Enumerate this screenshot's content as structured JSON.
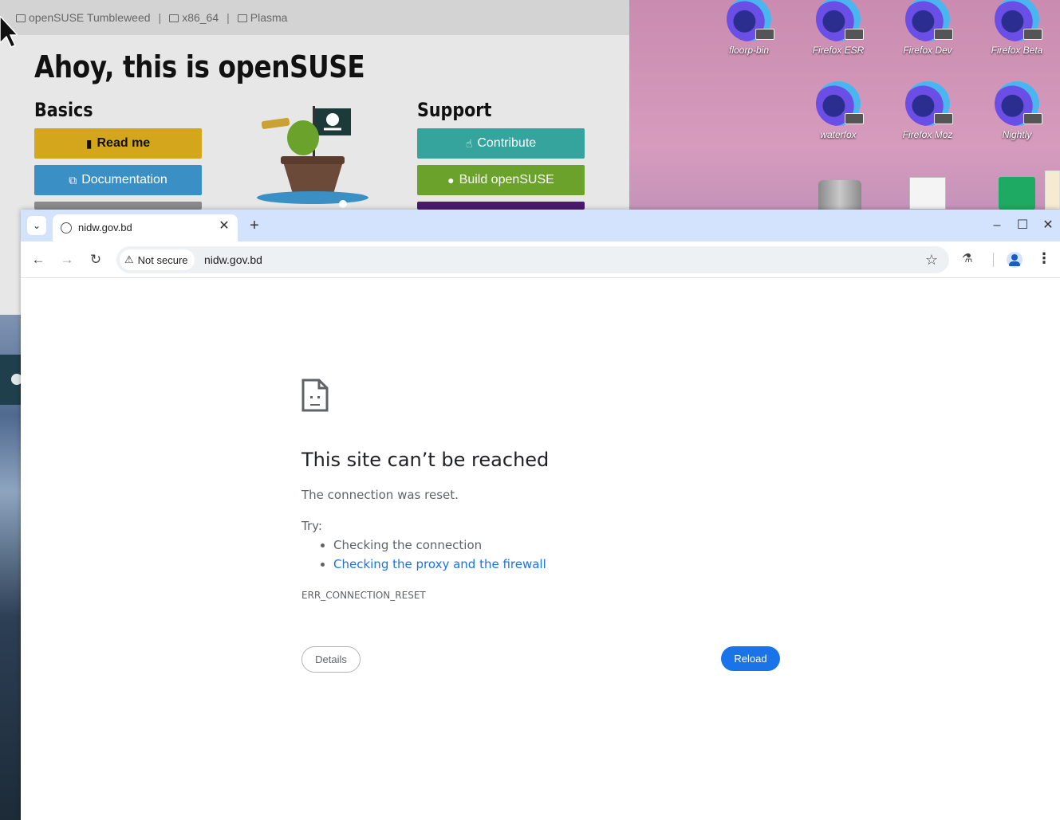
{
  "welcome": {
    "meta": [
      "openSUSE Tumbleweed",
      "x86_64",
      "Plasma"
    ],
    "meta_sep": "|",
    "title": "Ahoy, this is openSUSE",
    "basics": {
      "heading": "Basics",
      "buttons": [
        {
          "label": "Read me",
          "color": "#d4a61c"
        },
        {
          "label": "Documentation",
          "color": "#3a8fc4"
        }
      ]
    },
    "support": {
      "heading": "Support",
      "buttons": [
        {
          "label": "Contribute",
          "color": "#35a49c"
        },
        {
          "label": "Build openSUSE",
          "color": "#6aa22c"
        }
      ]
    }
  },
  "desktop_icons": [
    {
      "label": "floorp-bin",
      "icon": "firefox-icon"
    },
    {
      "label": "Firefox ESR",
      "icon": "firefox-icon"
    },
    {
      "label": "Firefox Dev",
      "icon": "firefox-icon"
    },
    {
      "label": "Firefox Beta",
      "icon": "firefox-icon"
    },
    {
      "label": "waterfox",
      "icon": "firefox-icon"
    },
    {
      "label": "Firefox Moz",
      "icon": "firefox-icon"
    },
    {
      "label": "Nightly",
      "icon": "firefox-icon"
    }
  ],
  "browser": {
    "tab": {
      "title": "nidw.gov.bd"
    },
    "security_chip": "Not secure",
    "url": "nidw.gov.bd",
    "accent": "#1a73e8",
    "tabstrip_color": "#d3e3fd"
  },
  "error": {
    "title": "This site can’t be reached",
    "description": "The connection was reset.",
    "try_label": "Try:",
    "suggestions": [
      "Checking the connection",
      "Checking the proxy and the firewall"
    ],
    "code": "ERR_CONNECTION_RESET",
    "details_button": "Details",
    "reload_button": "Reload"
  }
}
